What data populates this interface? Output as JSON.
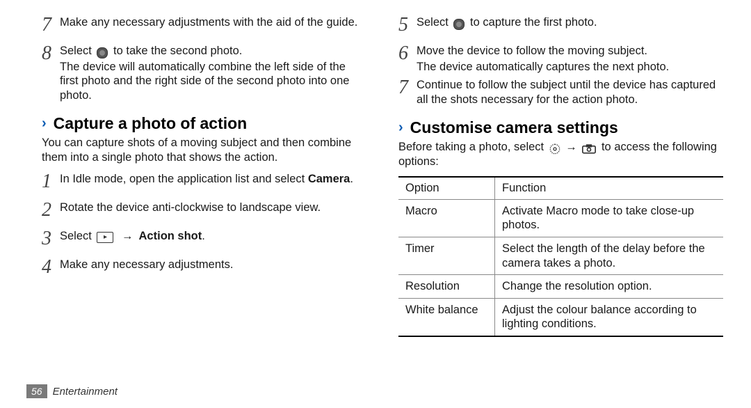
{
  "left": {
    "pre_steps": [
      {
        "n": "7",
        "text": "Make any necessary adjustments with the aid of the guide."
      },
      {
        "n": "8",
        "text": "Select",
        "after": " to take the second photo.",
        "sub": "The device will automatically combine the left side of the first photo and the right side of the second photo into one photo.",
        "icon": "shutter"
      }
    ],
    "section_title": "Capture a photo of action",
    "intro": "You can capture shots of a moving subject and then combine them into a single photo that shows the action.",
    "steps": [
      {
        "n": "1",
        "text": "In Idle mode, open the application list and select ",
        "bold_tail": "Camera",
        "period": "."
      },
      {
        "n": "2",
        "text": "Rotate the device anti-clockwise to landscape view."
      },
      {
        "n": "3",
        "text": "Select ",
        "icon": "ctx",
        "arrow": "→",
        "bold_tail": " Action shot",
        "period": "."
      },
      {
        "n": "4",
        "text": "Make any necessary adjustments."
      }
    ]
  },
  "right": {
    "pre_steps": [
      {
        "n": "5",
        "text": "Select",
        "after": " to capture the first photo.",
        "icon": "shutter"
      },
      {
        "n": "6",
        "text": "Move the device to follow the moving subject.",
        "sub": "The device automatically captures the next photo."
      },
      {
        "n": "7",
        "text": "Continue to follow the subject until the device has captured all the shots necessary for the action photo."
      }
    ],
    "section_title": "Customise camera settings",
    "intro_pre": "Before taking a photo, select ",
    "intro_mid": " → ",
    "intro_post": " to access the following options:",
    "table": {
      "headers": [
        "Option",
        "Function"
      ],
      "rows": [
        [
          "Macro",
          "Activate Macro mode to take close-up photos."
        ],
        [
          "Timer",
          "Select the length of the delay before the camera takes a photo."
        ],
        [
          "Resolution",
          "Change the resolution option."
        ],
        [
          "White balance",
          "Adjust the colour balance according to lighting conditions."
        ]
      ]
    }
  },
  "footer": {
    "page": "56",
    "section": "Entertainment"
  },
  "glyphs": {
    "chevron": "›",
    "ctx_label": "▸"
  }
}
